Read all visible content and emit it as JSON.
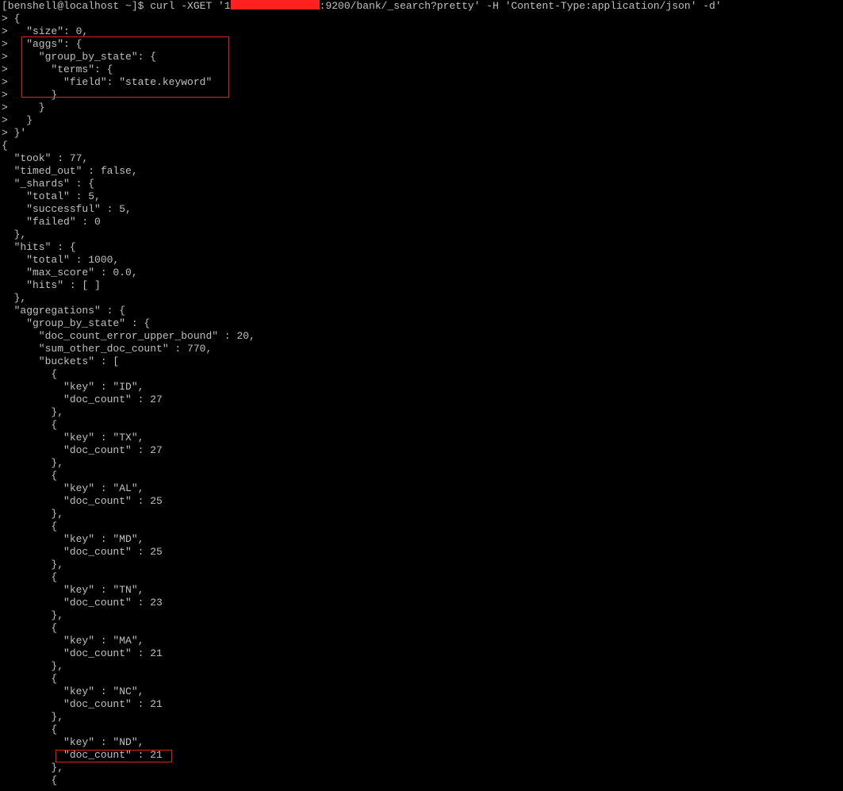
{
  "terminal": {
    "prompt": "[benshell@localhost ~]$ ",
    "command_before_redaction": "curl -XGET '1",
    "command_after_redaction": ":9200/bank/_search?pretty' -H 'Content-Type:application/json' -d'",
    "lines": [
      "> {",
      ">   \"size\": 0,",
      ">   \"aggs\": {",
      ">     \"group_by_state\": {",
      ">       \"terms\": {",
      ">         \"field\": \"state.keyword\"",
      ">       }",
      ">     }",
      ">   }",
      "> }'",
      "{",
      "  \"took\" : 77,",
      "  \"timed_out\" : false,",
      "  \"_shards\" : {",
      "    \"total\" : 5,",
      "    \"successful\" : 5,",
      "    \"failed\" : 0",
      "  },",
      "  \"hits\" : {",
      "    \"total\" : 1000,",
      "    \"max_score\" : 0.0,",
      "    \"hits\" : [ ]",
      "  },",
      "  \"aggregations\" : {",
      "    \"group_by_state\" : {",
      "      \"doc_count_error_upper_bound\" : 20,",
      "      \"sum_other_doc_count\" : 770,",
      "      \"buckets\" : [",
      "        {",
      "          \"key\" : \"ID\",",
      "          \"doc_count\" : 27",
      "        },",
      "        {",
      "          \"key\" : \"TX\",",
      "          \"doc_count\" : 27",
      "        },",
      "        {",
      "          \"key\" : \"AL\",",
      "          \"doc_count\" : 25",
      "        },",
      "        {",
      "          \"key\" : \"MD\",",
      "          \"doc_count\" : 25",
      "        },",
      "        {",
      "          \"key\" : \"TN\",",
      "          \"doc_count\" : 23",
      "        },",
      "        {",
      "          \"key\" : \"MA\",",
      "          \"doc_count\" : 21",
      "        },",
      "        {",
      "          \"key\" : \"NC\",",
      "          \"doc_count\" : 21",
      "        },",
      "        {",
      "          \"key\" : \"ND\",",
      "          \"doc_count\" : 21",
      "        },",
      "        {"
    ]
  },
  "colors": {
    "background": "#000000",
    "text": "#c0c0c0",
    "redaction": "#ff2020",
    "annotation_box": "#e02020"
  }
}
